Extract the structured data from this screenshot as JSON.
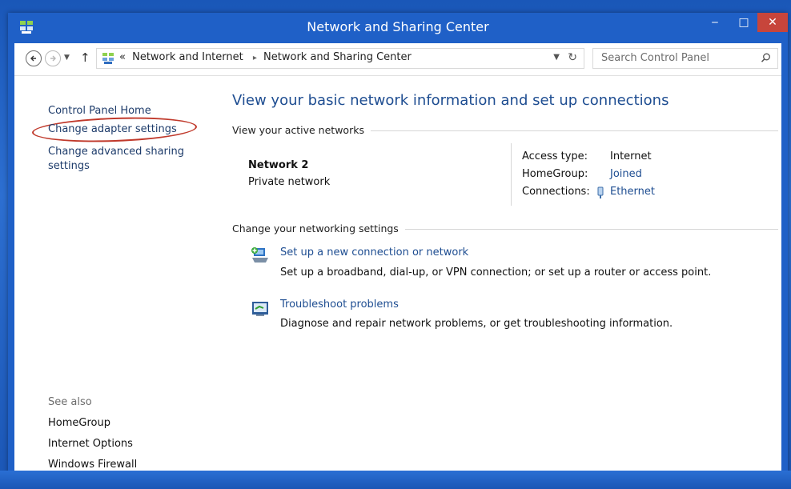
{
  "window": {
    "title": "Network and Sharing Center",
    "controls": {
      "minimize": "‒",
      "maximize": "□",
      "close": "✕"
    }
  },
  "addressbar": {
    "breadcrumb_overflow": "«",
    "crumbs": [
      "Network and Internet",
      "Network and Sharing Center"
    ],
    "separator": "▸",
    "search_placeholder": "Search Control Panel"
  },
  "sidebar": {
    "items": [
      {
        "label": "Control Panel Home"
      },
      {
        "label": "Change adapter settings"
      },
      {
        "label": "Change advanced sharing settings"
      }
    ],
    "see_also_label": "See also",
    "see_also": [
      "HomeGroup",
      "Internet Options",
      "Windows Firewall"
    ]
  },
  "main": {
    "heading": "View your basic network information and set up connections",
    "active_networks_label": "View your active networks",
    "network": {
      "name": "Network  2",
      "type": "Private network",
      "access_type_label": "Access type:",
      "access_type": "Internet",
      "homegroup_label": "HomeGroup:",
      "homegroup": "Joined",
      "connections_label": "Connections:",
      "connections": "Ethernet"
    },
    "change_settings_label": "Change your networking settings",
    "tasks": [
      {
        "link": "Set up a new connection or network",
        "desc": "Set up a broadband, dial-up, or VPN connection; or set up a router or access point.",
        "icon": "new-connection-icon"
      },
      {
        "link": "Troubleshoot problems",
        "desc": "Diagnose and repair network problems, or get troubleshooting information.",
        "icon": "troubleshoot-icon"
      }
    ]
  },
  "colors": {
    "frame": "#1f60c7",
    "link": "#1e4d91",
    "close_button": "#c7453b",
    "highlight_oval": "#c0392b"
  }
}
